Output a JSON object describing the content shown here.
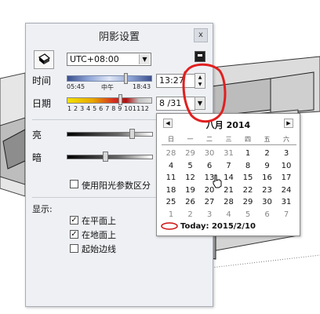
{
  "dialog": {
    "title": "阴影设置",
    "close_label": "x",
    "timezone": {
      "selected": "UTC+08:00"
    },
    "time": {
      "label": "时间",
      "start": "05:45",
      "mid": "中午",
      "end": "18:43",
      "value": "13:27"
    },
    "date": {
      "label": "日期",
      "month_ticks": "1 2 3 4 5 6 7 8 9 101112",
      "value": "8 /31"
    },
    "light": {
      "label": "亮"
    },
    "dark": {
      "label": "暗"
    },
    "sun_for_shading": {
      "label": "使用阳光参数区分",
      "checked": false
    },
    "display": {
      "label": "显示:",
      "options": [
        {
          "label": "在平面上",
          "checked": true
        },
        {
          "label": "在地面上",
          "checked": true
        },
        {
          "label": "起始边线",
          "checked": false
        }
      ]
    }
  },
  "calendar": {
    "title": "八月 2014",
    "weekdays": [
      "日",
      "一",
      "二",
      "三",
      "四",
      "五",
      "六"
    ],
    "days": [
      [
        "28",
        "29",
        "30",
        "31",
        "1",
        "2",
        "3"
      ],
      [
        "4",
        "5",
        "6",
        "7",
        "8",
        "9",
        "10"
      ],
      [
        "11",
        "12",
        "13",
        "14",
        "15",
        "16",
        "17"
      ],
      [
        "18",
        "19",
        "20",
        "21",
        "22",
        "23",
        "24"
      ],
      [
        "25",
        "26",
        "27",
        "28",
        "29",
        "30",
        "31"
      ],
      [
        "1",
        "2",
        "3",
        "4",
        "5",
        "6",
        "7"
      ]
    ],
    "today_label": "Today: 2015/2/10"
  },
  "colors": {
    "annotation": "#e02020",
    "dialog_bg": "#eef0f4"
  }
}
